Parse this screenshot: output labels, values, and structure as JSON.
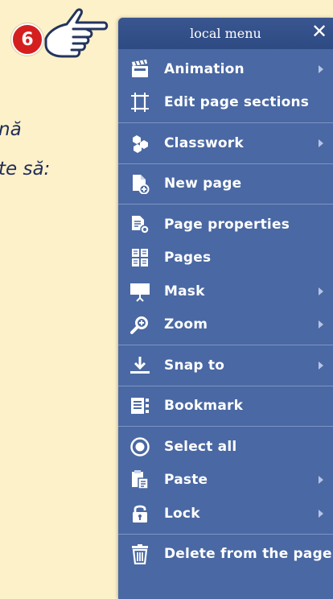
{
  "background": {
    "line1": "nă",
    "line2": "te să:"
  },
  "step_badge": {
    "number": "6",
    "color": "#d51f1f"
  },
  "menu": {
    "title": "local menu",
    "close_label": "✕",
    "groups": [
      {
        "items": [
          {
            "label": "Animation",
            "icon": "clapperboard-icon",
            "submenu": true
          },
          {
            "label": "Edit page sections",
            "icon": "page-sections-icon",
            "submenu": false
          }
        ]
      },
      {
        "items": [
          {
            "label": "Classwork",
            "icon": "classwork-icon",
            "submenu": true
          }
        ]
      },
      {
        "items": [
          {
            "label": "New page",
            "icon": "new-page-icon",
            "submenu": false
          }
        ]
      },
      {
        "items": [
          {
            "label": "Page properties",
            "icon": "page-properties-icon",
            "submenu": false
          },
          {
            "label": "Pages",
            "icon": "pages-icon",
            "submenu": false
          },
          {
            "label": "Mask",
            "icon": "mask-icon",
            "submenu": true
          },
          {
            "label": "Zoom",
            "icon": "zoom-icon",
            "submenu": true
          }
        ]
      },
      {
        "items": [
          {
            "label": "Snap to",
            "icon": "snap-icon",
            "submenu": true
          }
        ]
      },
      {
        "items": [
          {
            "label": "Bookmark",
            "icon": "bookmark-icon",
            "submenu": false
          }
        ]
      },
      {
        "items": [
          {
            "label": "Select all",
            "icon": "select-all-icon",
            "submenu": false
          },
          {
            "label": "Paste",
            "icon": "paste-icon",
            "submenu": true
          },
          {
            "label": "Lock",
            "icon": "lock-icon",
            "submenu": true
          }
        ]
      },
      {
        "items": [
          {
            "label": "Delete from the page",
            "icon": "trash-icon",
            "submenu": false
          }
        ]
      }
    ]
  },
  "colors": {
    "page_background": "#fdf1c9",
    "menu_background": "#4a68a3",
    "menu_header": "#2e4a83",
    "text_white": "#ffffff"
  }
}
